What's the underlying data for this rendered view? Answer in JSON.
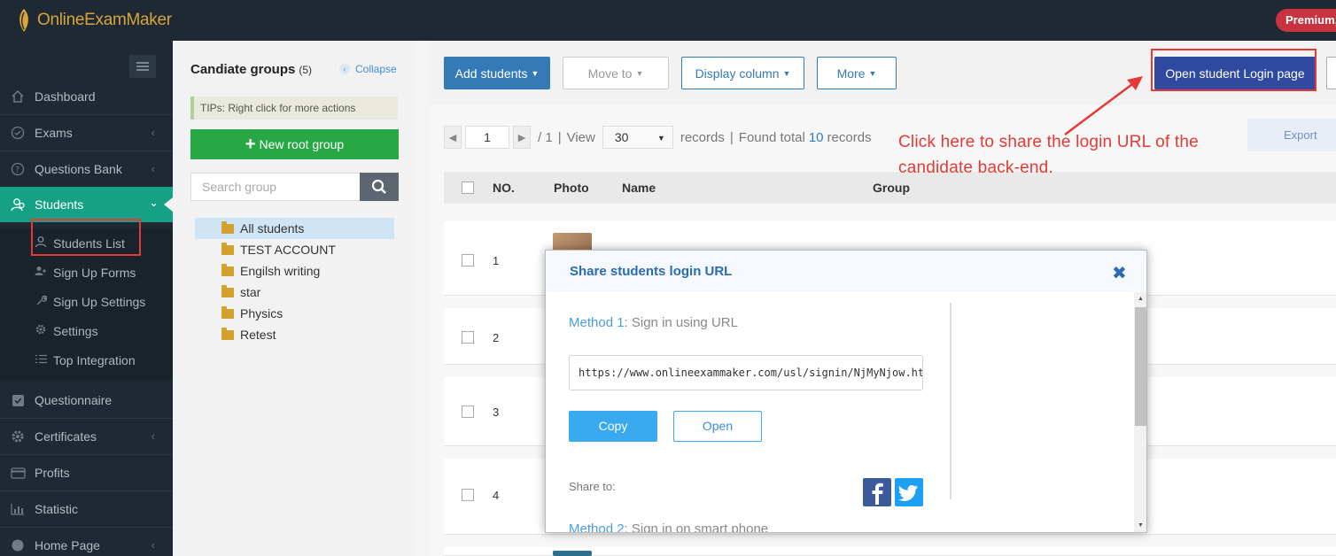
{
  "app": {
    "brand": "OnlineExamMaker",
    "plan_badge": "Premium,"
  },
  "sidebar": {
    "items": [
      {
        "label": "Dashboard",
        "icon": "home-icon"
      },
      {
        "label": "Exams",
        "icon": "check-circle-icon"
      },
      {
        "label": "Questions Bank",
        "icon": "question-circle-icon"
      },
      {
        "label": "Students",
        "icon": "users-icon"
      },
      {
        "label": "Questionnaire",
        "icon": "checkbox-icon"
      },
      {
        "label": "Certificates",
        "icon": "gear-icon"
      },
      {
        "label": "Profits",
        "icon": "card-icon"
      },
      {
        "label": "Statistic",
        "icon": "bar-chart-icon"
      },
      {
        "label": "Home Page",
        "icon": "globe-icon"
      }
    ],
    "students_sub": [
      {
        "label": "Students List",
        "icon": "user-icon"
      },
      {
        "label": "Sign Up Forms",
        "icon": "user-plus-icon"
      },
      {
        "label": "Sign Up Settings",
        "icon": "wrench-icon"
      },
      {
        "label": "Settings",
        "icon": "gear-icon"
      },
      {
        "label": "Top Integration",
        "icon": "list-icon"
      }
    ]
  },
  "groups": {
    "title": "Candiate groups",
    "count": "(5)",
    "collapse_label": "Collapse",
    "tips": "TIPs:  Right click for more actions",
    "new_root_label": "New root group",
    "search_placeholder": "Search group",
    "tree": [
      "All students",
      "TEST ACCOUNT",
      "Engilsh writing",
      "star",
      "Physics",
      "Retest"
    ]
  },
  "toolbar": {
    "add_students": "Add students",
    "move_to": "Move to",
    "display_column": "Display column",
    "more": "More",
    "open_login": "Open student Login page"
  },
  "pager": {
    "page": "1",
    "total_pages": "/ 1",
    "view_label": "View",
    "page_size": "30",
    "records_label": "records",
    "found_label": "Found total",
    "found_count": "10",
    "records_suffix": "records",
    "sep": "|"
  },
  "export_label": "Export",
  "table": {
    "columns": [
      "NO.",
      "Photo",
      "Name",
      "Group"
    ],
    "rows": [
      "1",
      "2",
      "3",
      "4"
    ]
  },
  "annotation": "Click here to share the login URL of the candidate back-end.",
  "modal": {
    "title": "Share students login URL",
    "method1_num": "Method 1",
    "method1_text": ": Sign in using URL",
    "url": "https://www.onlineexammaker.com/usl/signin/NjMyNjow.html",
    "copy_label": "Copy",
    "open_label": "Open",
    "share_label": "Share to:",
    "method2_num": "Method 2",
    "method2_text": ": Sign in on smart phone"
  },
  "colors": {
    "sidebar_bg": "#1f2933",
    "active_green": "#16a085",
    "primary_blue": "#337ab7",
    "annotation_red": "#e53935"
  }
}
